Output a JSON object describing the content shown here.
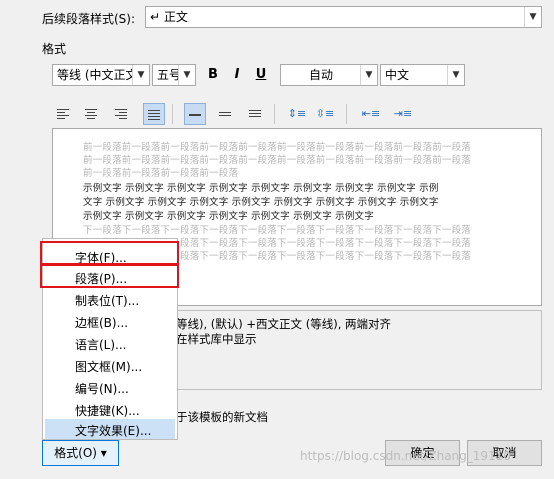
{
  "top": {
    "next_style_label": "后续段落样式(S):",
    "next_style_value": "↵ 正文"
  },
  "format_section_label": "格式",
  "font_bar": {
    "font_name": "等线 (中文正文)",
    "font_size": "五号",
    "bold": "B",
    "italic": "I",
    "underline": "U",
    "color": "自动",
    "language": "中文"
  },
  "preview": {
    "prev_lines": [
      "前一段落前一段落前一段落前一段落前一段落前一段落前一段落前一段落前一段落前一段落",
      "前一段落前一段落前一段落前一段落前一段落前一段落前一段落前一段落前一段落前一段落",
      "前一段落前一段落前一段落前一段落"
    ],
    "sample_lines": [
      "示例文字  示例文字  示例文字  示例文字  示例文字  示例文字  示例文字  示例文字  示例",
      "文字  示例文字  示例文字  示例文字  示例文字  示例文字  示例文字  示例文字  示例文字",
      "示例文字  示例文字  示例文字  示例文字  示例文字  示例文字  示例文字"
    ],
    "next_lines": [
      "下一段落下一段落下一段落下一段落下一段落下一段落下一段落下一段落下一段落下一段落",
      "下一段落下一段落下一段落下一段落下一段落下一段落下一段落下一段落下一段落下一段落",
      "下一段落下一段落下一段落下一段落下一段落下一段落下一段落下一段落下一段落下一段落"
    ]
  },
  "description": {
    "line1": "等线), (默认) +西文正文 (等线), 两端对齐",
    "line2": "在样式库中显示",
    "line3": "于该模板的新文档"
  },
  "menu": {
    "items": [
      "字体(F)...",
      "段落(P)...",
      "制表位(T)...",
      "边框(B)...",
      "语言(L)...",
      "图文框(M)...",
      "编号(N)...",
      "快捷键(K)...",
      "文字效果(E)..."
    ]
  },
  "buttons": {
    "format": "格式(O) ▾",
    "ok": "确定",
    "cancel": "取消"
  },
  "watermark": "https://blog.csdn.net/Zhang_19110",
  "colors": {
    "highlight_box": "#e0141d",
    "active_button": "#c7dcf2"
  }
}
